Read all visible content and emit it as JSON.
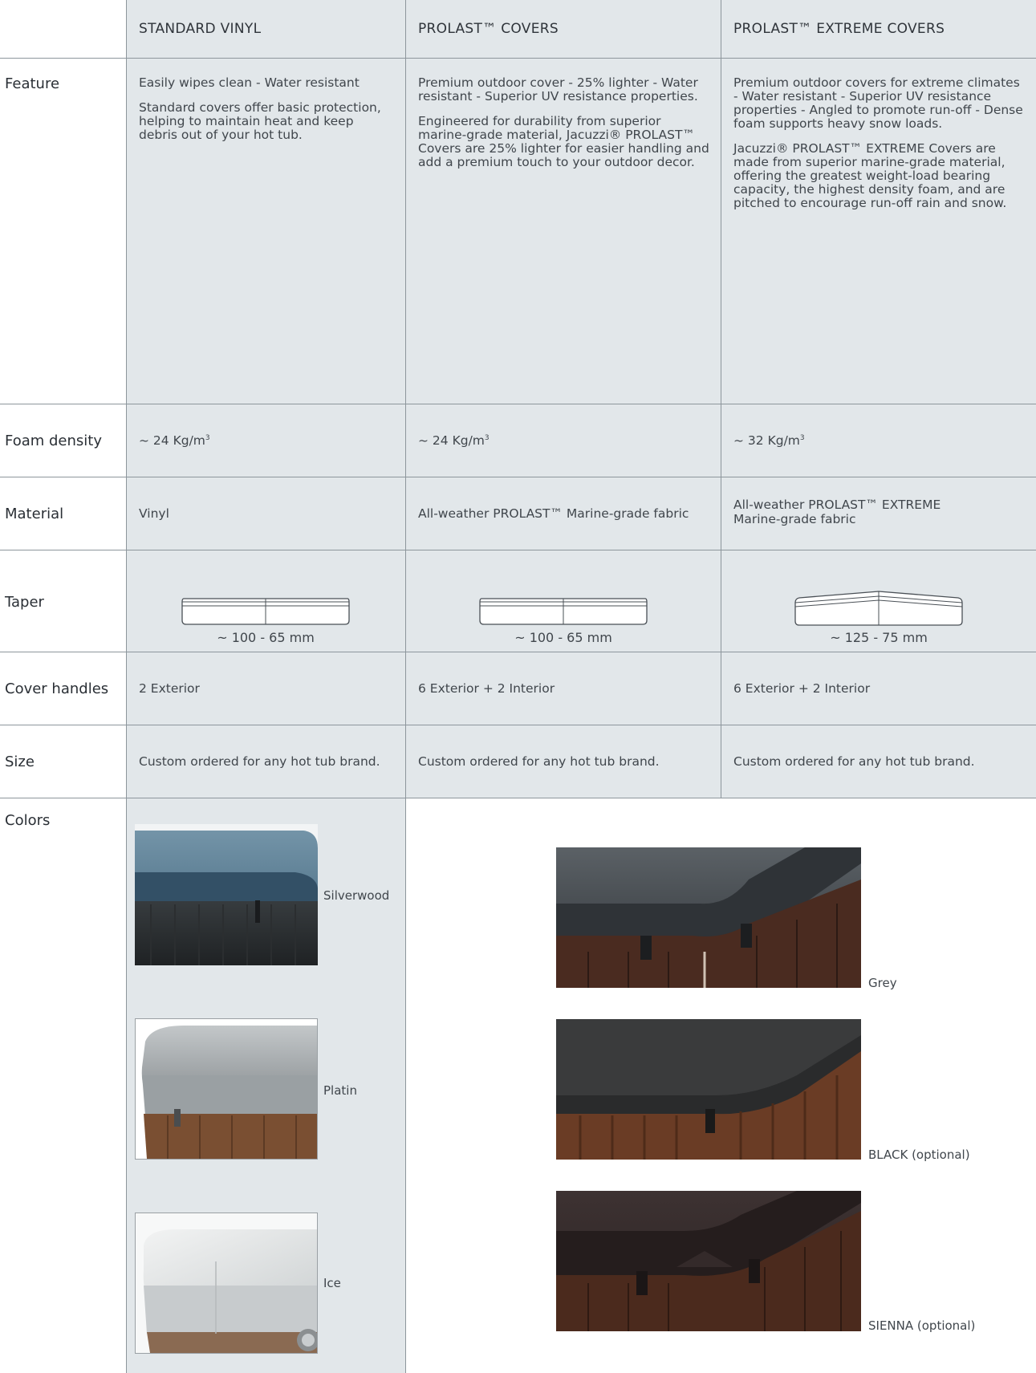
{
  "header": {
    "col1": "STANDARD VINYL",
    "col2": "PROLAST™ COVERS",
    "col3": "PROLAST™ EXTREME COVERS"
  },
  "rows": {
    "feature": {
      "label": "Feature",
      "col1": [
        "Easily wipes clean - Water resistant",
        "Standard covers offer basic protection, helping to maintain heat and keep debris out of your hot tub."
      ],
      "col2": [
        "Premium outdoor cover - 25% lighter - Water resistant - Superior UV resistance properties.",
        "Engineered for durability from superior marine-grade material, Jacuzzi® PROLAST™ Covers are 25% lighter for easier handling and add a premium touch to your outdoor decor."
      ],
      "col3": [
        "Premium outdoor covers for extreme climates - Water resistant - Superior UV resistance properties - Angled to promote run-off - Dense foam supports heavy snow loads.",
        "Jacuzzi® PROLAST™ EXTREME Covers are made from superior marine-grade material, offering the greatest weight-load bearing capacity, the highest density foam, and are pitched to encourage run-off rain and snow."
      ]
    },
    "foam": {
      "label": "Foam density",
      "col1": "~ 24 Kg/m",
      "col2": "~ 24 Kg/m",
      "col3": "~ 32 Kg/m",
      "sup": "3"
    },
    "material": {
      "label": "Material",
      "col1": "Vinyl",
      "col2": "All-weather PROLAST™ Marine-grade fabric",
      "col3": "All-weather PROLAST™ EXTREME Marine-grade fabric"
    },
    "taper": {
      "label": "Taper",
      "col1": "~ 100 - 65 mm",
      "col2": "~ 100 - 65 mm",
      "col3": "~ 125 - 75 mm"
    },
    "handles": {
      "label": "Cover handles",
      "col1": "2 Exterior",
      "col2": "6 Exterior + 2 Interior",
      "col3": "6 Exterior + 2 Interior"
    },
    "size": {
      "label": "Size",
      "col1": "Custom ordered for any hot tub brand.",
      "col2": "Custom ordered for any hot tub brand.",
      "col3": "Custom ordered for any hot tub brand."
    },
    "colors": {
      "label": "Colors",
      "vinyl": [
        "Silverwood",
        "Platin",
        "Ice"
      ],
      "prolast": [
        "Grey",
        "BLACK (optional)",
        "SIENNA (optional)"
      ]
    }
  },
  "colors": {
    "panel": "#e2e7ea",
    "rule": "#8d969c",
    "text": "#3a3f45"
  }
}
